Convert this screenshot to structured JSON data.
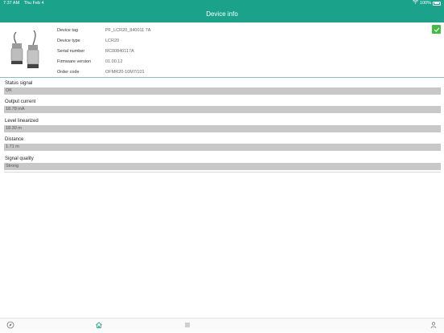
{
  "status_bar": {
    "time": "7:37 AM",
    "date": "Thu Feb 4",
    "battery": "100%"
  },
  "header": {
    "title": "Device info"
  },
  "device": {
    "image_icon": "ultrasonic-sensor-icon",
    "status_icon": "checkmark-icon",
    "status_color": "#3fbf3f",
    "fields": [
      {
        "label": "Device tag",
        "value": "PF_LCR20_840011 7A"
      },
      {
        "label": "Device type",
        "value": "LCR20"
      },
      {
        "label": "Serial number",
        "value": "RC00840117A"
      },
      {
        "label": "Firmware version",
        "value": "01.00.12"
      },
      {
        "label": "Order code",
        "value": "OFMR20-10M7/101"
      }
    ]
  },
  "params": [
    {
      "label": "Status signal",
      "value": "OK"
    },
    {
      "label": "Output current",
      "value": "18.78 mA"
    },
    {
      "label": "Level linearized",
      "value": "18.30 m"
    },
    {
      "label": "Distance",
      "value": "1.71 m"
    },
    {
      "label": "Signal quality",
      "value": "Strong"
    }
  ],
  "tab_bar": {
    "items": [
      {
        "icon": "compass-icon"
      },
      {
        "icon": "home-icon",
        "active": true
      },
      {
        "icon": "menu-icon"
      },
      {
        "icon": "user-icon"
      }
    ]
  },
  "colors": {
    "accent": "#1aa38a",
    "value_background": "#c8c8c8"
  }
}
